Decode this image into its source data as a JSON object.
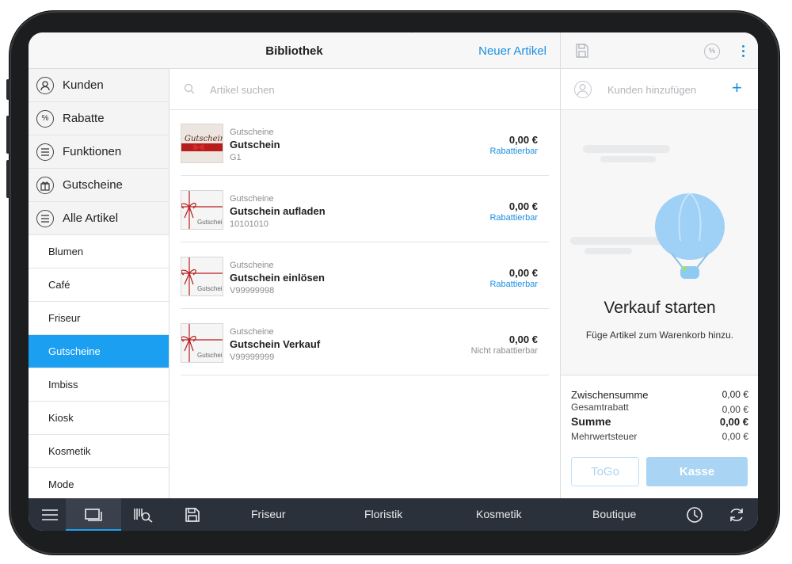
{
  "header": {
    "title": "Bibliothek",
    "new_item_label": "Neuer Artikel"
  },
  "sidebar": {
    "top_items": [
      {
        "label": "Kunden",
        "icon": "person-icon"
      },
      {
        "label": "Rabatte",
        "icon": "percent-icon"
      },
      {
        "label": "Funktionen",
        "icon": "menu-lines-icon"
      },
      {
        "label": "Gutscheine",
        "icon": "gift-icon"
      },
      {
        "label": "Alle Artikel",
        "icon": "menu-lines-icon"
      }
    ],
    "categories": [
      {
        "label": "Blumen"
      },
      {
        "label": "Café"
      },
      {
        "label": "Friseur"
      },
      {
        "label": "Gutscheine",
        "active": true
      },
      {
        "label": "Imbiss"
      },
      {
        "label": "Kiosk"
      },
      {
        "label": "Kosmetik"
      },
      {
        "label": "Mode"
      }
    ]
  },
  "search": {
    "placeholder": "Artikel suchen"
  },
  "items": [
    {
      "category": "Gutscheine",
      "name": "Gutschein",
      "sku": "G1",
      "price": "0,00 €",
      "discount": "Rabattierbar",
      "thumb_text": "Gutschein"
    },
    {
      "category": "Gutscheine",
      "name": "Gutschein aufladen",
      "sku": "10101010",
      "price": "0,00 €",
      "discount": "Rabattierbar",
      "thumb_text": "Gutschei"
    },
    {
      "category": "Gutscheine",
      "name": "Gutschein einlösen",
      "sku": "V99999998",
      "price": "0,00 €",
      "discount": "Rabattierbar",
      "thumb_text": "Gutschei"
    },
    {
      "category": "Gutscheine",
      "name": "Gutschein Verkauf",
      "sku": "V99999999",
      "price": "0,00 €",
      "discount": "Nicht rabattierbar",
      "thumb_text": "Gutschei"
    }
  ],
  "cart": {
    "customer_placeholder": "Kunden hinzufügen",
    "empty_title": "Verkauf starten",
    "empty_subtitle": "Füge Artikel zum Warenkorb hinzu.",
    "totals": [
      {
        "label": "Zwischensumme",
        "value": "0,00 €"
      },
      {
        "label": "Gesamtrabatt",
        "value": "0,00 €"
      },
      {
        "label": "Summe",
        "value": "0,00 €"
      },
      {
        "label": "Mehrwertsteuer",
        "value": "0,00 €"
      }
    ],
    "togo_label": "ToGo",
    "checkout_label": "Kasse"
  },
  "bottombar": {
    "tabs": [
      "Friseur",
      "Floristik",
      "Kosmetik",
      "Boutique"
    ]
  },
  "colors": {
    "accent": "#1b9ff1",
    "link": "#1b8fe0",
    "bottombar": "#2b313b"
  }
}
